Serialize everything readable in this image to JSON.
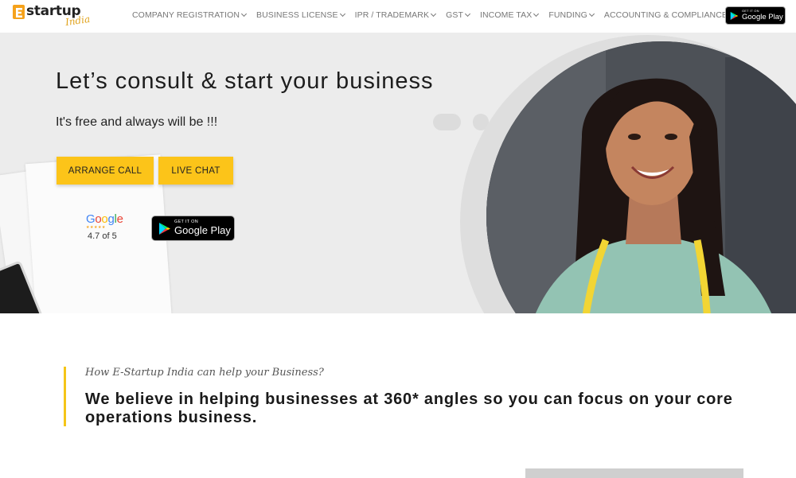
{
  "brand": {
    "logo_text": "startup",
    "logo_script": "India"
  },
  "nav": {
    "items": [
      {
        "label": "COMPANY REGISTRATION"
      },
      {
        "label": "BUSINESS LICENSE"
      },
      {
        "label": "IPR / TRADEMARK"
      },
      {
        "label": "GST"
      },
      {
        "label": "INCOME TAX"
      },
      {
        "label": "FUNDING"
      },
      {
        "label": "ACCOUNTING & COMPLIANCES"
      }
    ],
    "play_badge": {
      "top": "GET IT ON",
      "bottom": "Google Play"
    }
  },
  "hero": {
    "title": "Let’s consult & start your business",
    "subtitle": "It's free and always will be !!!",
    "arrange_call": "ARRANGE CALL",
    "live_chat": "LIVE CHAT",
    "google": {
      "word": "Google",
      "stars": "★★★★★",
      "rating": "4.7 of 5"
    },
    "play_badge": {
      "top": "GET IT ON",
      "bottom": "Google Play"
    }
  },
  "section": {
    "kicker": "How E-Startup India can help your Business?",
    "heading": "We believe in helping businesses at 360* angles so you can focus on your core operations business."
  },
  "colors": {
    "accent": "#fcc419",
    "bar": "#f5c518",
    "hero_bg": "#ececec"
  },
  "icons": [
    "chevron-down-icon",
    "google-play-icon",
    "star-icon"
  ]
}
